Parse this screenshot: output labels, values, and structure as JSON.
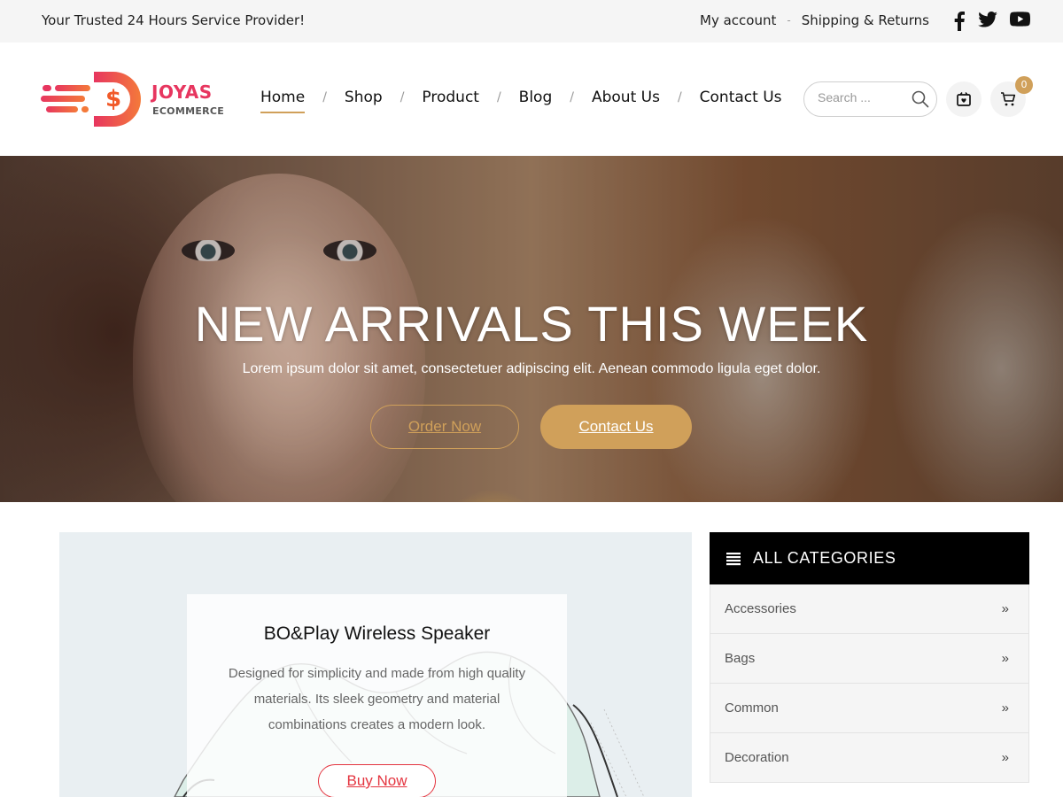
{
  "topbar": {
    "tagline": "Your Trusted 24 Hours Service Provider!",
    "links": [
      "My account",
      "Shipping & Returns"
    ],
    "separator": "-",
    "social": [
      "facebook-icon",
      "twitter-icon",
      "youtube-icon"
    ]
  },
  "header": {
    "logo": {
      "brand_line1": "JOYAS",
      "brand_line2": "ECOMMERCE",
      "colors": [
        "#f15a29",
        "#e7365f"
      ]
    },
    "nav": {
      "items": [
        "Home",
        "Shop",
        "Product",
        "Blog",
        "About Us",
        "Contact Us"
      ],
      "active": "Home",
      "separator": "/"
    },
    "search": {
      "placeholder": "Search ..."
    },
    "wishlist_icon": "gift-icon",
    "cart": {
      "icon": "cart-icon",
      "count": "0"
    }
  },
  "hero": {
    "title": "NEW ARRIVALS THIS WEEK",
    "subtitle": "Lorem ipsum dolor sit amet, consectetuer adipiscing elit. Aenean commodo ligula eget dolor.",
    "button_primary": "Order Now",
    "button_secondary": "Contact Us"
  },
  "promo": {
    "title": "BO&Play Wireless Speaker",
    "description": "Designed for simplicity and made from high quality materials. Its sleek geometry and material combinations creates a modern look.",
    "button": "Buy Now"
  },
  "categories": {
    "title": "ALL CATEGORIES",
    "items": [
      "Accessories",
      "Bags",
      "Common",
      "Decoration"
    ],
    "chevron": "»"
  },
  "colors": {
    "accent": "#d0a05a",
    "brand_red": "#e4343f",
    "topbar_bg": "#f5f5f5",
    "category_header_bg": "#000000"
  }
}
